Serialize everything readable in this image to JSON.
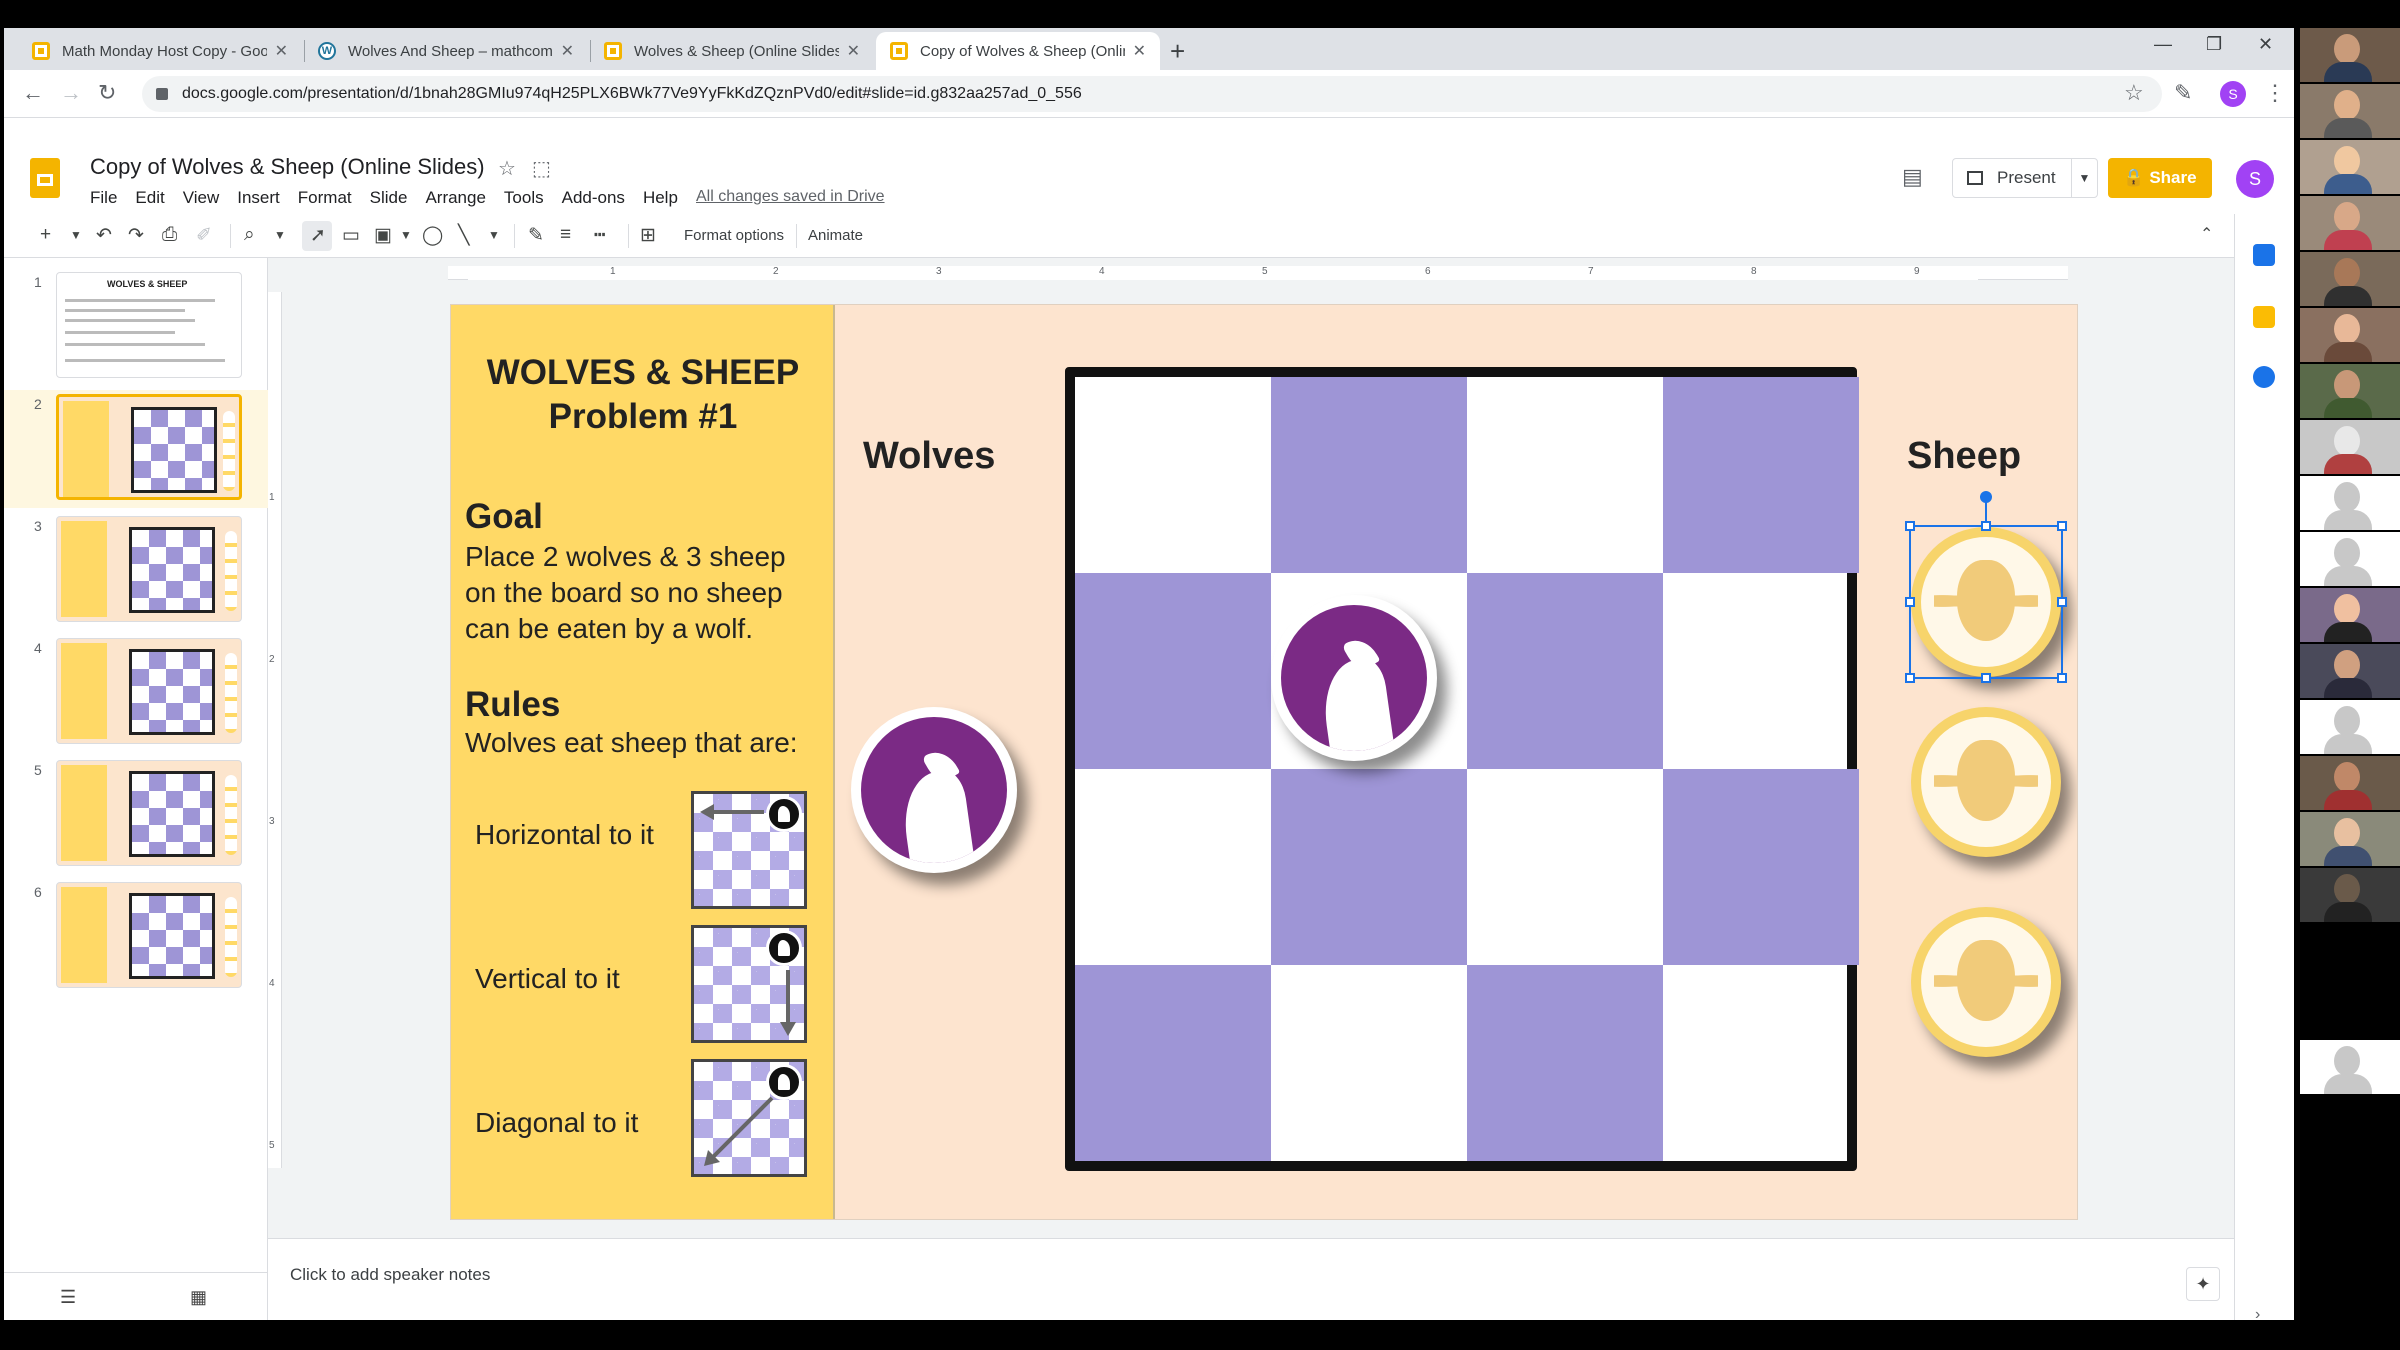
{
  "browser": {
    "tabs": [
      {
        "title": "Math Monday Host Copy - Goog",
        "icon": "slides-icon",
        "active": false
      },
      {
        "title": "Wolves And Sheep – mathcomm",
        "icon": "wordpress-icon",
        "active": false
      },
      {
        "title": "Wolves & Sheep (Online Slides)",
        "icon": "slides-icon",
        "active": false
      },
      {
        "title": "Copy of Wolves & Sheep (Online",
        "icon": "slides-icon",
        "active": true
      }
    ],
    "url": "docs.google.com/presentation/d/1bnah28GMIu974qH25PLX6BWk77Ve9YyFkKdZQznPVd0/edit#slide=id.g832aa257ad_0_556",
    "profile_initial": "S"
  },
  "app": {
    "doc_title": "Copy of Wolves & Sheep (Online Slides)",
    "menu": [
      "File",
      "Edit",
      "View",
      "Insert",
      "Format",
      "Slide",
      "Arrange",
      "Tools",
      "Add-ons",
      "Help"
    ],
    "save_status": "All changes saved in Drive",
    "present_label": "Present",
    "share_label": "Share",
    "user_initial": "S"
  },
  "toolbar": {
    "format_options": "Format options",
    "animate": "Animate"
  },
  "ruler": {
    "h_ticks": [
      "1",
      "2",
      "3",
      "4",
      "5",
      "6",
      "7",
      "8",
      "9"
    ],
    "v_ticks": [
      "1",
      "2",
      "3",
      "4",
      "5"
    ]
  },
  "filmstrip": {
    "slides": [
      "1",
      "2",
      "3",
      "4",
      "5",
      "6"
    ],
    "active_index": 2,
    "slide1_title": "WOLVES & SHEEP"
  },
  "slide": {
    "title_line1": "WOLVES & SHEEP",
    "title_line2": "Problem #1",
    "goal_heading": "Goal",
    "goal_text": "Place 2 wolves & 3 sheep on the board so no sheep can be eaten by a wolf.",
    "rules_heading": "Rules",
    "rules_text": "Wolves eat sheep that are:",
    "rule_1": "Horizontal to it",
    "rule_2": "Vertical to it",
    "rule_3": "Diagonal to it",
    "wolves_label": "Wolves",
    "sheep_label": "Sheep"
  },
  "notes": {
    "placeholder": "Click to add speaker notes"
  },
  "colors": {
    "accent": "#f4b400",
    "wolf": "#7b2a85",
    "board_dark": "#9e95d6",
    "slide_bg": "#fde4cf",
    "panel_bg": "#ffd966"
  }
}
